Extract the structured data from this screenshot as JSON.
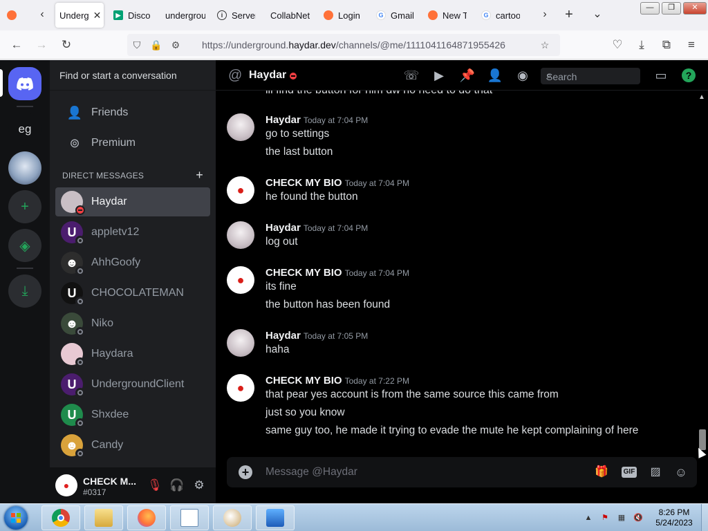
{
  "browser": {
    "tabs": [
      {
        "label": "",
        "icon": "firefox-icon",
        "color": "#ff7139"
      },
      {
        "label": "Underg",
        "active": true,
        "icon": "discord-icon",
        "color": "#5865f2"
      },
      {
        "label": "Disco",
        "icon": "play-store-icon",
        "color": "#00a173"
      },
      {
        "label": "undergrou",
        "icon": "",
        "color": ""
      },
      {
        "label": "Server",
        "icon": "info-icon",
        "color": "#555555"
      },
      {
        "label": "CollabNet",
        "icon": "",
        "color": ""
      },
      {
        "label": "Login",
        "icon": "firefox-icon",
        "color": "#ff7139"
      },
      {
        "label": "Gmail",
        "icon": "google-icon",
        "color": "#4285f4"
      },
      {
        "label": "New T",
        "icon": "firefox-icon",
        "color": "#ff7139"
      },
      {
        "label": "cartoo",
        "icon": "google-icon",
        "color": "#4285f4"
      }
    ],
    "tab_close": "✕",
    "nav": {
      "back": "←",
      "forward": "→",
      "reload": "↻"
    },
    "url_prefix": "https://underground.",
    "url_host": "haydar.dev",
    "url_path": "/channels/@me/1111041164871955426",
    "window_controls": {
      "minimize": "—",
      "maximize": "❐",
      "close": "✕"
    }
  },
  "discord": {
    "colors": {
      "blurple": "#5865f2",
      "green": "#23a55a",
      "dnd": "#f23f43",
      "bg": "#000000",
      "sidebar": "#1e1f22"
    },
    "servers": [
      {
        "label": "eg"
      }
    ],
    "search_placeholder": "Find or start a conversation",
    "nav": {
      "friends": "Friends",
      "premium": "Premium"
    },
    "dm_header": "Direct Messages",
    "dm_add": "+",
    "direct_messages": [
      {
        "name": "Haydar",
        "avatar_letter": "",
        "avatar_color": "#c9bfc5",
        "status": "dnd",
        "active": true
      },
      {
        "name": "appletv12",
        "avatar_letter": "U",
        "avatar_color": "#4b1d6e",
        "status": "offline"
      },
      {
        "name": "AhhGoofy",
        "avatar_letter": "☻",
        "avatar_color": "#2d2d2d",
        "status": "offline"
      },
      {
        "name": "CHOCOLATEMAN",
        "avatar_letter": "U",
        "avatar_color": "#111111",
        "status": "offline"
      },
      {
        "name": "Niko",
        "avatar_letter": "☻",
        "avatar_color": "#3a4a3a",
        "status": "offline"
      },
      {
        "name": "Haydara",
        "avatar_letter": "",
        "avatar_color": "#e8c9d3",
        "status": "offline"
      },
      {
        "name": "UndergroundClient",
        "avatar_letter": "U",
        "avatar_color": "#4b1d6e",
        "status": "offline"
      },
      {
        "name": "Shxdee",
        "avatar_letter": "U",
        "avatar_color": "#1f8b4c",
        "status": "offline"
      },
      {
        "name": "Candy",
        "avatar_letter": "☻",
        "avatar_color": "#d9a23b",
        "status": "offline"
      }
    ],
    "user": {
      "name": "CHECK M...",
      "tag": "#0317"
    },
    "chat": {
      "channel_name": "Haydar",
      "search_placeholder": "Search",
      "cut_line": "ill find the button for him dw no need to do that",
      "groups": [
        {
          "author": "Haydar",
          "avatar": "haydar",
          "time": "Today at 7:04 PM",
          "lines": [
            "go to settings",
            "the last button"
          ]
        },
        {
          "author": "CHECK MY BIO",
          "avatar": "bio",
          "time": "Today at 7:04 PM",
          "lines": [
            "he found the button"
          ]
        },
        {
          "author": "Haydar",
          "avatar": "haydar",
          "time": "Today at 7:04 PM",
          "lines": [
            "log out"
          ]
        },
        {
          "author": "CHECK MY BIO",
          "avatar": "bio",
          "time": "Today at 7:04 PM",
          "lines": [
            "its fine",
            "the button has been found"
          ]
        },
        {
          "author": "Haydar",
          "avatar": "haydar",
          "time": "Today at 7:05 PM",
          "lines": [
            "haha"
          ]
        },
        {
          "author": "CHECK MY BIO",
          "avatar": "bio",
          "time": "Today at 7:22 PM",
          "lines": [
            "that pear yes account is from the same source this came from",
            "just so you know",
            "same guy too, he made it trying to evade the mute he kept complaining of here"
          ]
        }
      ],
      "composer_placeholder": "Message @Haydar",
      "gif_label": "GIF"
    }
  },
  "taskbar": {
    "clock_time": "8:26 PM",
    "clock_date": "5/24/2023"
  }
}
